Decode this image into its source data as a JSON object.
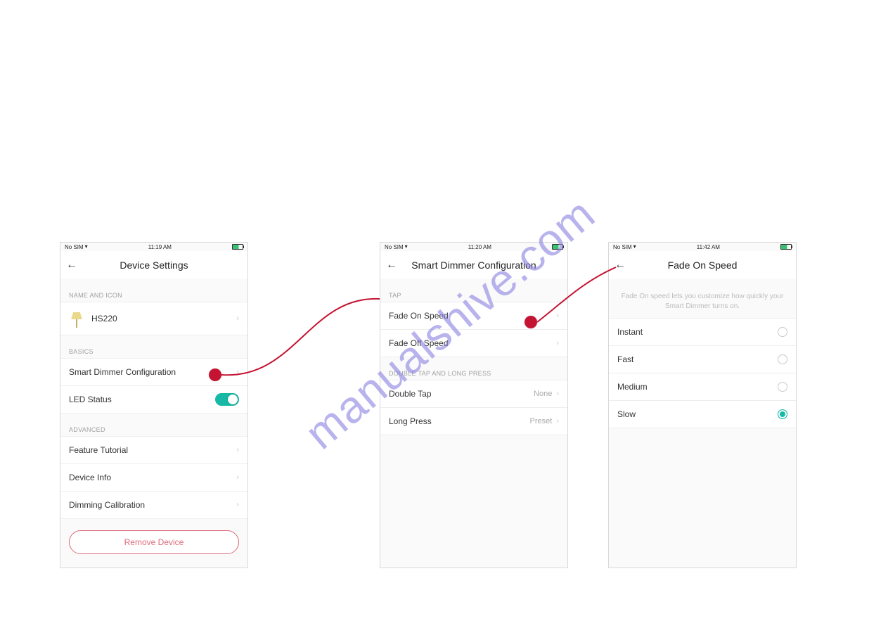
{
  "watermark": "manualshive.com",
  "screen1": {
    "status": {
      "carrier": "No SIM",
      "time": "11:19 AM"
    },
    "title": "Device Settings",
    "sections": {
      "name_icon_header": "NAME AND ICON",
      "device_name": "HS220",
      "basics_header": "BASICS",
      "smart_dimmer": "Smart Dimmer Configuration",
      "led_status": "LED Status",
      "advanced_header": "ADVANCED",
      "feature_tutorial": "Feature Tutorial",
      "device_info": "Device Info",
      "dimming_calibration": "Dimming Calibration"
    },
    "remove": "Remove Device"
  },
  "screen2": {
    "status": {
      "carrier": "No SIM",
      "time": "11:20 AM"
    },
    "title": "Smart Dimmer Configuration",
    "tap_header": "TAP",
    "fade_on": "Fade On Speed",
    "fade_off": "Fade Off Speed",
    "dt_header": "DOUBLE TAP AND LONG PRESS",
    "double_tap": "Double Tap",
    "double_tap_val": "None",
    "long_press": "Long Press",
    "long_press_val": "Preset"
  },
  "screen3": {
    "status": {
      "carrier": "No SIM",
      "time": "11:42 AM"
    },
    "title": "Fade On Speed",
    "description": "Fade On speed lets you customize how quickly your Smart Dimmer turns on.",
    "options": {
      "instant": "Instant",
      "fast": "Fast",
      "medium": "Medium",
      "slow": "Slow"
    }
  }
}
